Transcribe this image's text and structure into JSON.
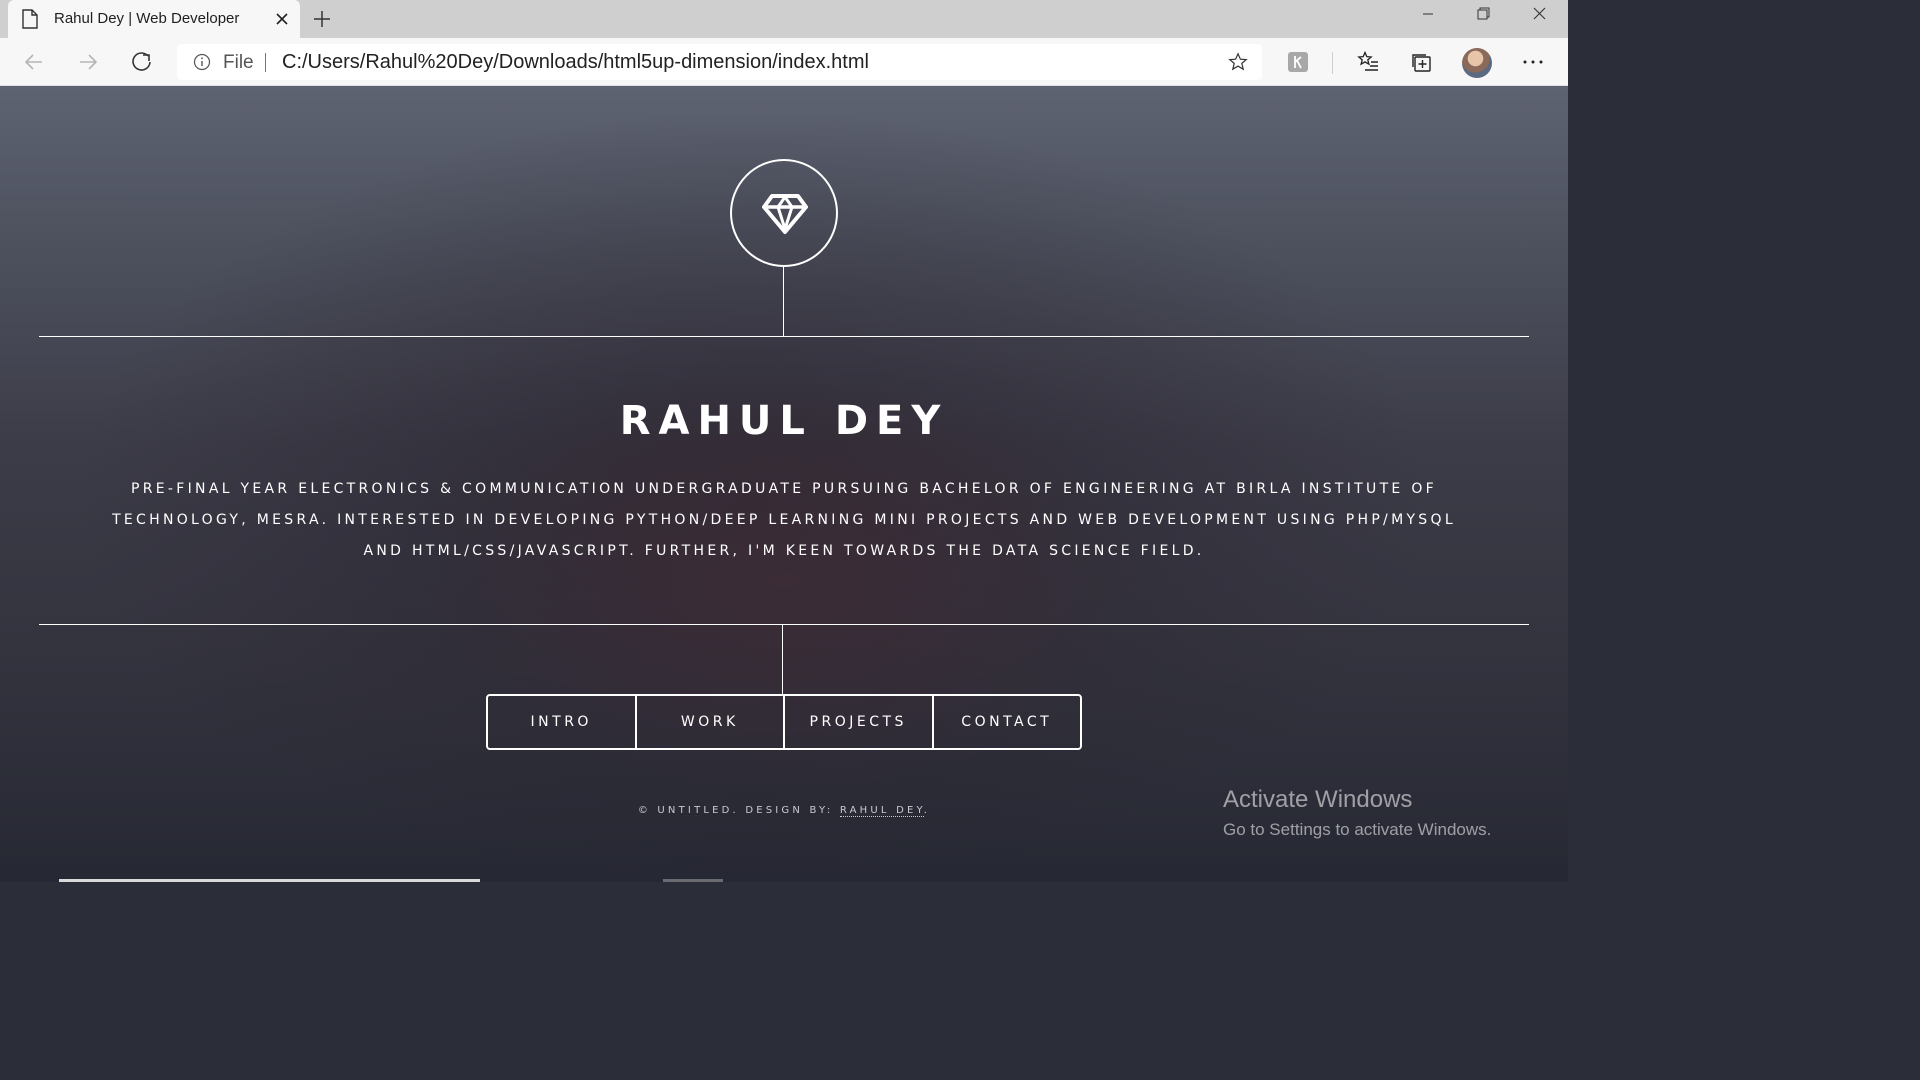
{
  "browser": {
    "tab_title": "Rahul Dey | Web Developer",
    "address_scheme_label": "File",
    "url": "C:/Users/Rahul%20Dey/Downloads/html5up-dimension/index.html"
  },
  "header": {
    "logo_icon": "diamond-icon",
    "name": "RAHUL DEY",
    "bio": "Pre-final year Electronics & Communication undergraduate pursuing Bachelor of Engineering at Birla Institute of Technology, Mesra. Interested in developing Python/Deep Learning mini projects and Web Development using PHP/MySQL and HTML/CSS/JavaScript. Further, I'm keen towards the Data Science field."
  },
  "nav": {
    "items": [
      {
        "label": "Intro"
      },
      {
        "label": "Work"
      },
      {
        "label": "Projects"
      },
      {
        "label": "Contact"
      }
    ]
  },
  "footer": {
    "prefix": "© UNTITLED. DESIGN BY: ",
    "credit": "RAHUL DEY",
    "suffix": "."
  },
  "watermark": {
    "title": "Activate Windows",
    "subtitle": "Go to Settings to activate Windows."
  }
}
